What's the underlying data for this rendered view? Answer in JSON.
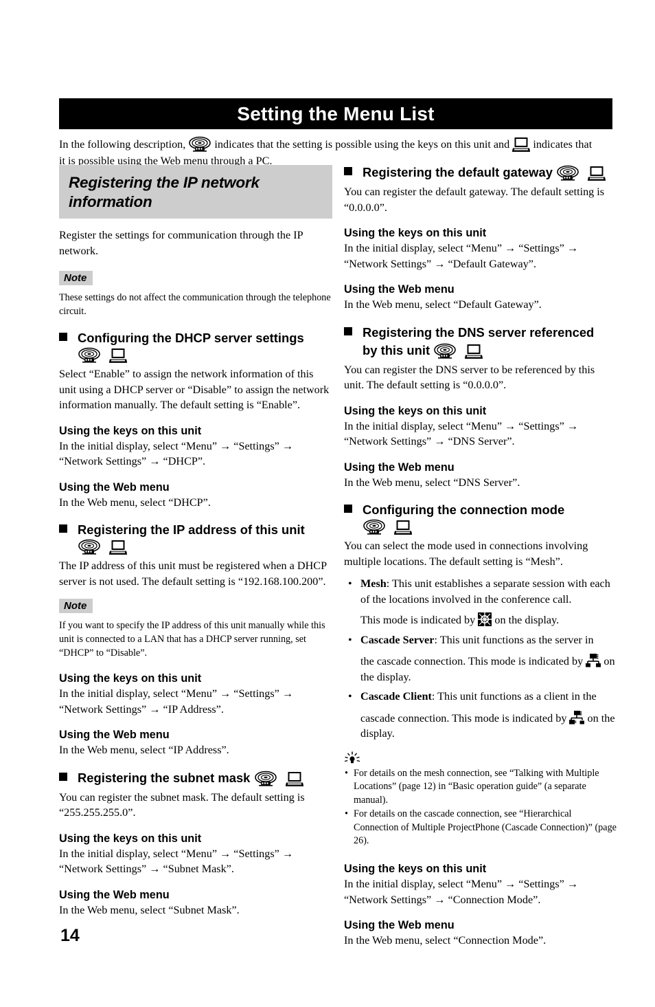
{
  "page": {
    "title": "Setting the Menu List",
    "number": "14",
    "intro": {
      "line1_a": "In the following description,",
      "line1_b": "indicates that the setting is possible using the keys on this unit and",
      "line1_c": "indicates that",
      "line2": "it is possible using the Web menu through a PC."
    }
  },
  "icons": {
    "unit": "conference-unit-icon",
    "pc": "laptop-pc-icon",
    "mesh": "mesh-mode-icon",
    "cascade_server": "cascade-server-icon",
    "cascade_client": "cascade-client-icon",
    "hint": "hint-lightbulb-icon",
    "square": "black-square-bullet-icon"
  },
  "labels": {
    "using_keys": "Using the keys on this unit",
    "using_web": "Using the Web menu",
    "note": "Note"
  },
  "left_column": {
    "section": {
      "title_line1": "Registering the IP network",
      "title_line2": "information",
      "intro": "Register the settings for communication through the IP network.",
      "note": "These settings do not affect the communication through the telephone circuit."
    },
    "topics": [
      {
        "heading": "Configuring the DHCP server settings",
        "body": "Select “Enable” to assign the network information of this unit using a DHCP server or “Disable” to assign the network information manually. The default setting is “Enable”.",
        "keys_body": "In the initial display, select “Menu” → “Settings” → “Network Settings” → “DHCP”.",
        "web_body": "In the Web menu, select “DHCP”."
      },
      {
        "heading": "Registering the IP address of this unit",
        "body": "The IP address of this unit must be registered when a DHCP server is not used. The default setting is “192.168.100.200”.",
        "note": "If you want to specify the IP address of this unit manually while this unit is connected to a LAN that has a DHCP server running, set “DHCP” to “Disable”.",
        "keys_body": "In the initial display, select “Menu” → “Settings” → “Network Settings” → “IP Address”.",
        "web_body": "In the Web menu, select “IP Address”."
      },
      {
        "heading": "Registering the subnet mask",
        "body": "You can register the subnet mask. The default setting is “255.255.255.0”.",
        "keys_body": "In the initial display, select “Menu” → “Settings” → “Network Settings” → “Subnet Mask”.",
        "web_body": "In the Web menu, select “Subnet Mask”."
      }
    ]
  },
  "right_column": {
    "topics": [
      {
        "heading": "Registering the default gateway",
        "body": "You can register the default gateway. The default setting is “0.0.0.0”.",
        "keys_body": "In the initial display, select “Menu” → “Settings” → “Network Settings” → “Default Gateway”.",
        "web_body": "In the Web menu, select “Default Gateway”."
      },
      {
        "heading_line1": "Registering the DNS server referenced",
        "heading_line2": "by this unit",
        "body": "You can register the DNS server to be referenced by this unit. The default setting is “0.0.0.0”.",
        "keys_body": "In the initial display, select “Menu” → “Settings” → “Network Settings” → “DNS Server”.",
        "web_body": "In the Web menu, select “DNS Server”."
      }
    ],
    "connection_mode": {
      "heading": "Configuring the connection mode",
      "body": "You can select the mode used in connections involving multiple locations. The default setting is “Mesh”.",
      "modes": [
        {
          "name": "Mesh",
          "desc": ": This unit establishes a separate session with each of the locations involved in the conference call.",
          "indicated_a": "This mode is indicated by",
          "indicated_b": "on the display."
        },
        {
          "name": "Cascade Server",
          "desc": ": This unit functions as the server in",
          "indicated_a": "the cascade connection. This mode is indicated by",
          "indicated_b": "on the display."
        },
        {
          "name": "Cascade Client",
          "desc": ": This unit functions as a client in the",
          "indicated_a": "cascade connection. This mode is indicated by",
          "indicated_b": "on the display."
        }
      ],
      "hints": [
        "For details on the mesh connection, see “Talking with Multiple Locations” (page 12) in “Basic operation guide” (a separate manual).",
        "For details on the cascade connection, see “Hierarchical Connection of Multiple ProjectPhone (Cascade Connection)” (page 26)."
      ],
      "keys_body": "In the initial display, select “Menu” → “Settings” → “Network Settings” → “Connection Mode”.",
      "web_body": "In the Web menu, select “Connection Mode”."
    }
  }
}
